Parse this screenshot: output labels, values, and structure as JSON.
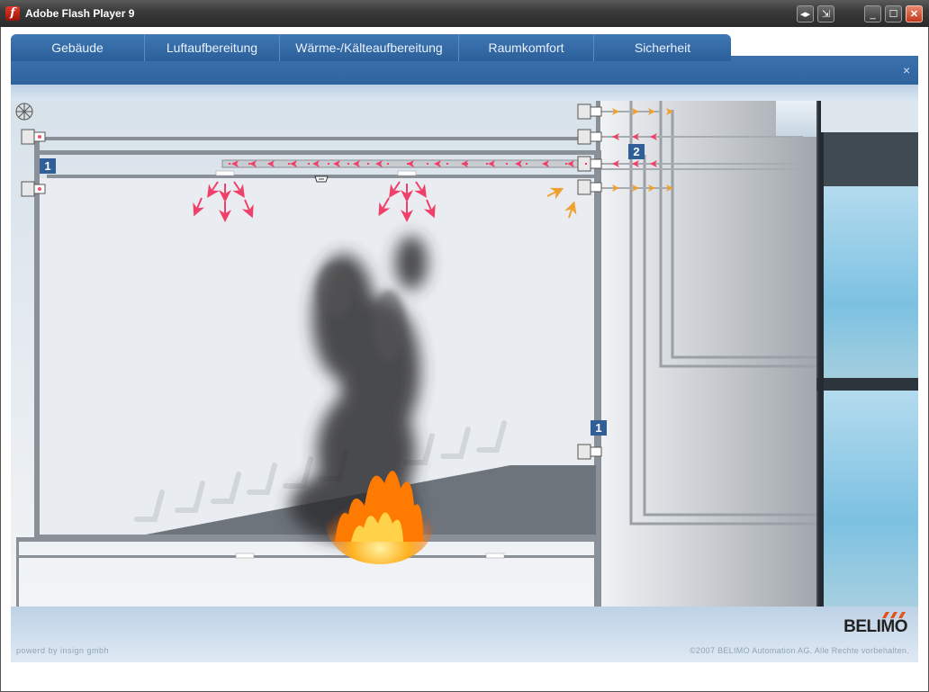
{
  "window": {
    "title": "Adobe Flash Player 9",
    "icon": "flash-icon",
    "controls": [
      "restore-icon",
      "fullscreen-icon",
      "minimize-icon",
      "maximize-icon",
      "close-icon"
    ]
  },
  "nav": {
    "tabs": [
      {
        "label": "Gebäude"
      },
      {
        "label": "Luftaufbereitung"
      },
      {
        "label": "Wärme-/Kälteaufbereitung"
      },
      {
        "label": "Raumkomfort"
      },
      {
        "label": "Sicherheit"
      }
    ],
    "close_label": "×"
  },
  "scene": {
    "zone_labels": [
      "1",
      "2",
      "1"
    ],
    "colors": {
      "supply_arrow": "#f0406a",
      "exhaust_arrow": "#f0a030",
      "fire": "#ff8a00",
      "smoke": "#333333"
    }
  },
  "footer": {
    "powered": "powerd by insign gmbh",
    "copyright": "©2007 BELIMO Automation AG. Alle Rechte vorbehalten.",
    "logo": "BELIMO"
  }
}
